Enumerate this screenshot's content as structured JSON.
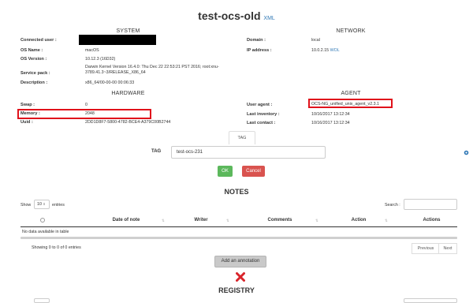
{
  "header": {
    "title": "test-ocs-old",
    "xml_link": "XML"
  },
  "system": {
    "heading": "SYSTEM",
    "rows": [
      {
        "label": "Connected user :",
        "value": ""
      },
      {
        "label": "OS Name :",
        "value": "macOS"
      },
      {
        "label": "OS Version :",
        "value": "10.12.3 (16D32)"
      },
      {
        "label": "Service pack :",
        "value": "Darwin Kernel Version 16.4.0: Thu Dec 22 22:53:21 PST 2016; root:xnu-3789.41.3~3/RELEASE_X86_64"
      },
      {
        "label": "Description :",
        "value": "x86_64/00-00-00 00:06:33"
      }
    ]
  },
  "network": {
    "heading": "NETWORK",
    "rows": [
      {
        "label": "Domain :",
        "value": "local"
      },
      {
        "label": "IP address :",
        "value": "10.0.2.15",
        "link": "WOL"
      }
    ]
  },
  "hardware": {
    "heading": "HARDWARE",
    "rows": [
      {
        "label": "Swap :",
        "value": "0"
      },
      {
        "label": "Memory :",
        "value": "2048"
      },
      {
        "label": "Uuid :",
        "value": "2DD1D8F7-5800-4782-BCE4-A379C00B2744"
      }
    ]
  },
  "agent": {
    "heading": "AGENT",
    "rows": [
      {
        "label": "User agent :",
        "value": "OCS-NG_unified_unix_agent_v2.3.1"
      },
      {
        "label": "Last inventory :",
        "value": "10/16/2017 13:12:34"
      },
      {
        "label": "Last contact :",
        "value": "10/16/2017 13:12:34"
      }
    ]
  },
  "tag_tab": {
    "label": "TAG"
  },
  "tag_form": {
    "label": "TAG",
    "value": "test-ocs-231",
    "ok": "OK",
    "cancel": "Cancel"
  },
  "notes": {
    "heading": "NOTES",
    "show_prefix": "Show",
    "show_value": "10",
    "show_suffix": "entries",
    "search_label": "Search :",
    "columns": [
      "Date of note",
      "Writer",
      "Comments",
      "Action",
      "Actions"
    ],
    "empty": "No data available in table",
    "info": "Showing 0 to 0 of 0 entries",
    "previous": "Previous",
    "next": "Next",
    "add_button": "Add an annotation"
  },
  "registry": {
    "heading": "REGISTRY"
  },
  "colors": {
    "accent": "#337ab7",
    "ok": "#5cb85c",
    "cancel": "#d9534f",
    "highlight": "#e0121b",
    "delete": "#d9252b"
  }
}
